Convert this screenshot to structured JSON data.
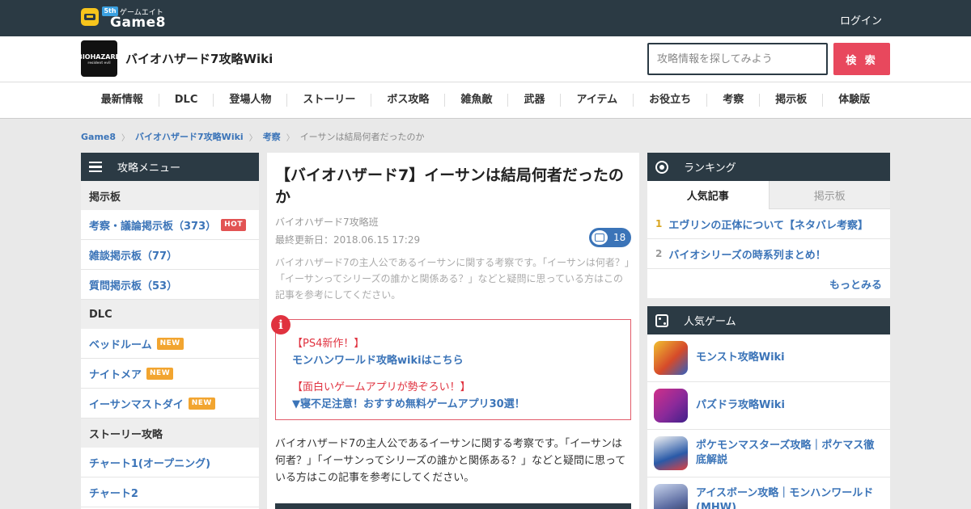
{
  "site": {
    "logo_text": "Game8",
    "logo_badge": "5th",
    "logo_kana": "ゲームエイト",
    "login": "ログイン"
  },
  "wiki": {
    "icon_text": "BIOHAZARD",
    "icon_sub": "resident evil",
    "title": "バイオハザード7攻略Wiki",
    "search_placeholder": "攻略情報を探してみよう",
    "search_button": "検 索"
  },
  "nav": [
    "最新情報",
    "DLC",
    "登場人物",
    "ストーリー",
    "ボス攻略",
    "雑魚敵",
    "武器",
    "アイテム",
    "お役立ち",
    "考察",
    "掲示板",
    "体験版"
  ],
  "breadcrumb": {
    "items": [
      "Game8",
      "バイオハザード7攻略Wiki",
      "考察",
      "イーサンは結局何者だったのか"
    ],
    "separator": "〉"
  },
  "left_menu": {
    "title": "攻略メニュー",
    "categories": [
      {
        "label": "掲示板",
        "items": [
          {
            "label": "考察・議論掲示板（373）",
            "tag": "HOT"
          },
          {
            "label": "雑談掲示板（77）",
            "tag": ""
          },
          {
            "label": "質問掲示板（53）",
            "tag": ""
          }
        ]
      },
      {
        "label": "DLC",
        "items": [
          {
            "label": "ベッドルーム",
            "tag": "NEW"
          },
          {
            "label": "ナイトメア",
            "tag": "NEW"
          },
          {
            "label": "イーサンマストダイ",
            "tag": "NEW"
          }
        ]
      },
      {
        "label": "ストーリー攻略",
        "items": [
          {
            "label": "チャート1(オープニング)",
            "tag": ""
          },
          {
            "label": "チャート2",
            "tag": ""
          }
        ]
      }
    ]
  },
  "article": {
    "title": "【バイオハザード7】イーサンは結局何者だったのか",
    "author": "バイオハザード7攻略班",
    "updated": "最終更新日：2018.06.15 17:29",
    "comment_count": "18",
    "summary": "バイオハザード7の主人公であるイーサンに関する考察です。「イーサンは何者？」「イーサンってシリーズの誰かと関係ある？」などと疑問に思っている方はこの記事を参考にしてください。",
    "notice": {
      "icon": "i",
      "line1": "【PS4新作！】",
      "link1": "モンハンワールド攻略wikiはこちら",
      "line2": "【面白いゲームアプリが勢ぞろい！】",
      "link2": "▼寝不足注意！おすすめ無料ゲームアプリ30選！"
    },
    "body": "バイオハザード7の主人公であるイーサンに関する考察です。「イーサンは何者？」「イーサンってシリーズの誰かと関係ある？」などと疑問に思っている方はこの記事を参考にしてください。"
  },
  "ranking": {
    "title": "ランキング",
    "tabs": [
      "人気記事",
      "掲示板"
    ],
    "items": [
      {
        "rank": "1",
        "title": "エヴリンの正体について【ネタバレ考察】"
      },
      {
        "rank": "2",
        "title": "バイオシリーズの時系列まとめ！"
      }
    ],
    "more": "もっとみる"
  },
  "popular_games": {
    "title": "人気ゲーム",
    "items": [
      {
        "name": "モンスト攻略Wiki",
        "color": "#d64a2a"
      },
      {
        "name": "パズドラ攻略Wiki",
        "color": "#8a2a9a"
      },
      {
        "name": "ポケモンマスターズ攻略｜ポケマス徹底解説",
        "color": "#2a5aa8"
      },
      {
        "name": "アイスボーン攻略｜モンハンワールド(MHW)",
        "color": "#5a6aa0"
      }
    ]
  },
  "colors": {
    "header_bg": "#2b3a44",
    "accent_red": "#e8485d",
    "link_blue": "#3b74b8"
  }
}
